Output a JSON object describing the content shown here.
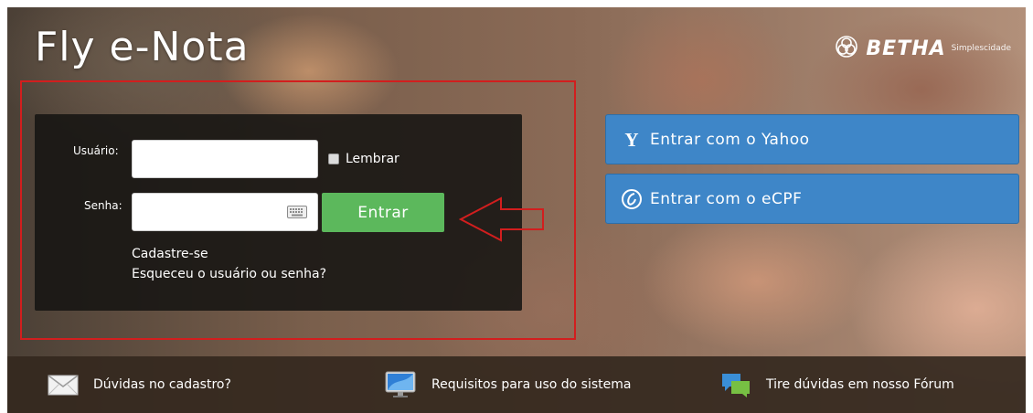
{
  "header": {
    "title": "Fly e-Nota",
    "brand_name": "BETHA",
    "brand_tagline": "Simplescidade",
    "brand_icon": "betha-logo-icon"
  },
  "login": {
    "username_label": "Usuário:",
    "username_value": "",
    "password_label": "Senha:",
    "password_value": "",
    "remember_label": "Lembrar",
    "remember_checked": false,
    "submit_label": "Entrar",
    "signup_link": "Cadastre-se",
    "forgot_link": "Esqueceu o usuário ou senha?"
  },
  "social": [
    {
      "label": "Entrar com o Yahoo",
      "icon": "yahoo-icon"
    },
    {
      "label": "Entrar com o eCPF",
      "icon": "ecpf-icon"
    }
  ],
  "footer": {
    "items": [
      {
        "label": "Dúvidas no cadastro?",
        "icon": "mail-icon"
      },
      {
        "label": "Requisitos para uso do sistema",
        "icon": "monitor-icon"
      },
      {
        "label": "Tire dúvidas em nosso Fórum",
        "icon": "chat-icon"
      }
    ]
  },
  "colors": {
    "accent_green": "#5cb85c",
    "social_blue": "#3e86c8",
    "highlight_red": "#d21e1e"
  }
}
